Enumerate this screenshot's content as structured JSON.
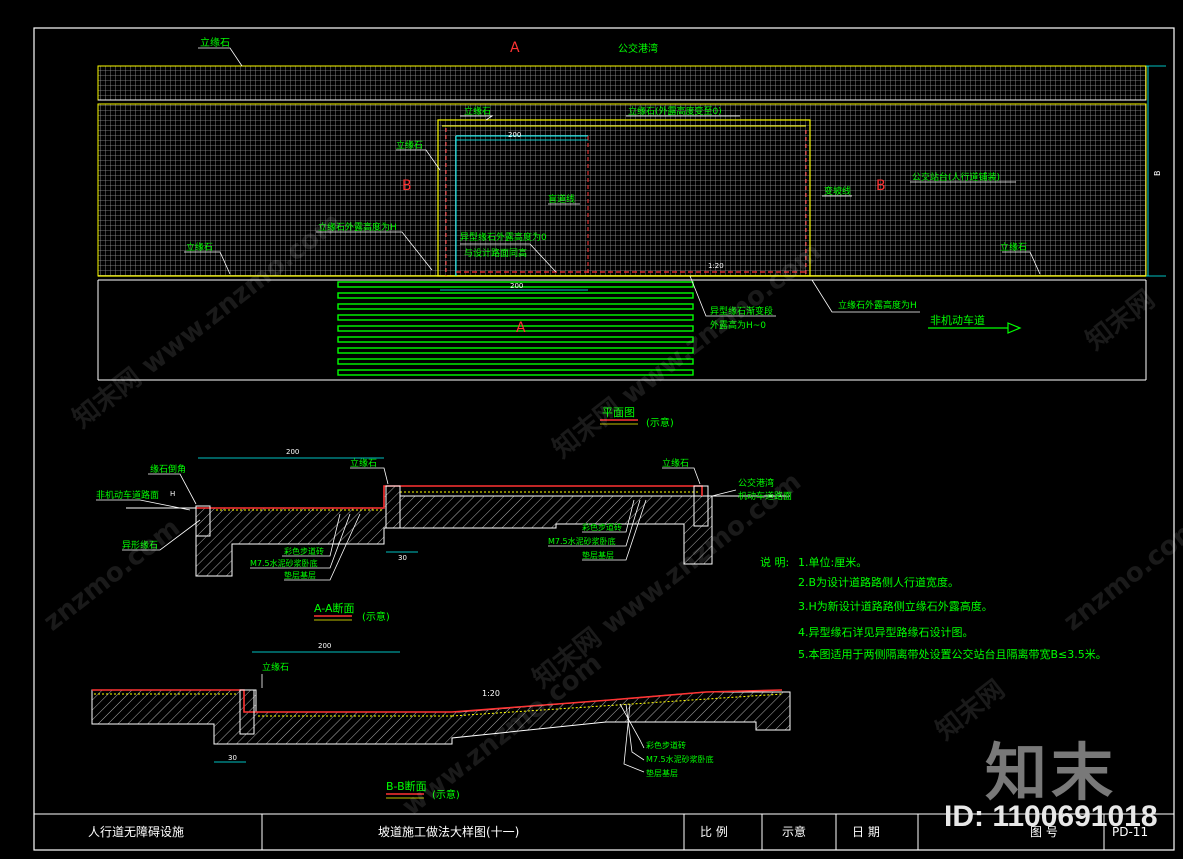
{
  "plan": {
    "curb_top_label": "立缘石",
    "section_mark_top": "A",
    "bus_bay_label": "公交港湾",
    "curb_label_2": "立缘石",
    "curb_top_height_label": "立缘石(外露高度变至0)",
    "curb_label_3": "立缘石",
    "mark_b_left": "B",
    "mark_b_right": "B",
    "dim_200_top": "200",
    "bus_platform_label": "公交站台(人行道铺装)",
    "curb_exposed_h_label": "立缘石外露高度为H",
    "special_curb_height_label": "异型缘石外露高度为0",
    "flush_label": "与设计路面同高",
    "blind_line_label": "盲道线",
    "tactile_label": "变坡线",
    "curb_left_label": "立缘石",
    "curb_right_label": "立缘石",
    "dim_1_20": "1:20",
    "dim_200_mid": "200",
    "section_mark_bottom": "A",
    "transition_label_1": "异型缘石渐变段",
    "transition_label_2": "外露高为H~0",
    "curb_right_h_label": "立缘石外露高度为H",
    "lane_label": "非机动车道",
    "plan_title": "平面图",
    "plan_scale": "(示意)",
    "dim_b": "B"
  },
  "section_aa": {
    "dim_200": "200",
    "curb_chamfer_label": "缘石倒角",
    "curb_label": "立缘石",
    "curb_label_r": "立缘石",
    "bus_bay": "公交港湾",
    "vehicle_surface": "机动车道路面",
    "nonmotor_surface": "非机动车道路面",
    "special_curb": "异形缘石",
    "paving": "彩色步道砖",
    "mortar": "M7.5水泥砂浆卧底",
    "base": "垫层基层",
    "paving_r": "彩色步道砖",
    "mortar_r": "M7.5水泥砂浆卧底",
    "base_r": "垫层基层",
    "dim_30": "30",
    "h_mark": "H",
    "title": "A-A断面",
    "scale": "(示意)"
  },
  "section_bb": {
    "dim_200": "200",
    "curb_label": "立缘石",
    "dim_30": "30",
    "slope": "1:20",
    "paving": "彩色步道砖",
    "mortar": "M7.5水泥砂浆卧底",
    "base": "垫层基层",
    "title": "B-B断面",
    "scale": "(示意)"
  },
  "notes": {
    "heading": "说 明:",
    "items": [
      "1.单位:厘米。",
      "2.B为设计道路路侧人行道宽度。",
      "3.H为新设计道路路侧立缘石外露高度。",
      "4.异型缘石详见异型路缘石设计图。",
      "5.本图适用于两侧隔离带处设置公交站台且隔离带宽B≤3.5米。"
    ]
  },
  "title_block": {
    "project": "人行道无障碍设施",
    "drawing": "坡道施工做法大样图(十一)",
    "scale_label": "比 例",
    "scale_value": "示意",
    "date_label": "日 期",
    "sheet_label": "图 号",
    "sheet_no": "PD-11"
  },
  "watermark": {
    "brand": "知末",
    "id": "ID: 1100691018",
    "tiles": [
      "知末网 www.znzmo.com",
      "知末网 www.znzmo.com",
      "znzmo.com",
      "知末网",
      "www.znzmo.com",
      "知末网 www.znzmo.com",
      "znzmo.com",
      "知末网"
    ]
  },
  "colors": {
    "background": "#000000",
    "frame": "#ffffff",
    "text_yellow": "#ffff00",
    "text_green": "#00ff00",
    "line_red": "#ff0000",
    "mesh": "#d0d0d0",
    "cyan": "#00ffff",
    "magenta": "#ff00ff"
  }
}
